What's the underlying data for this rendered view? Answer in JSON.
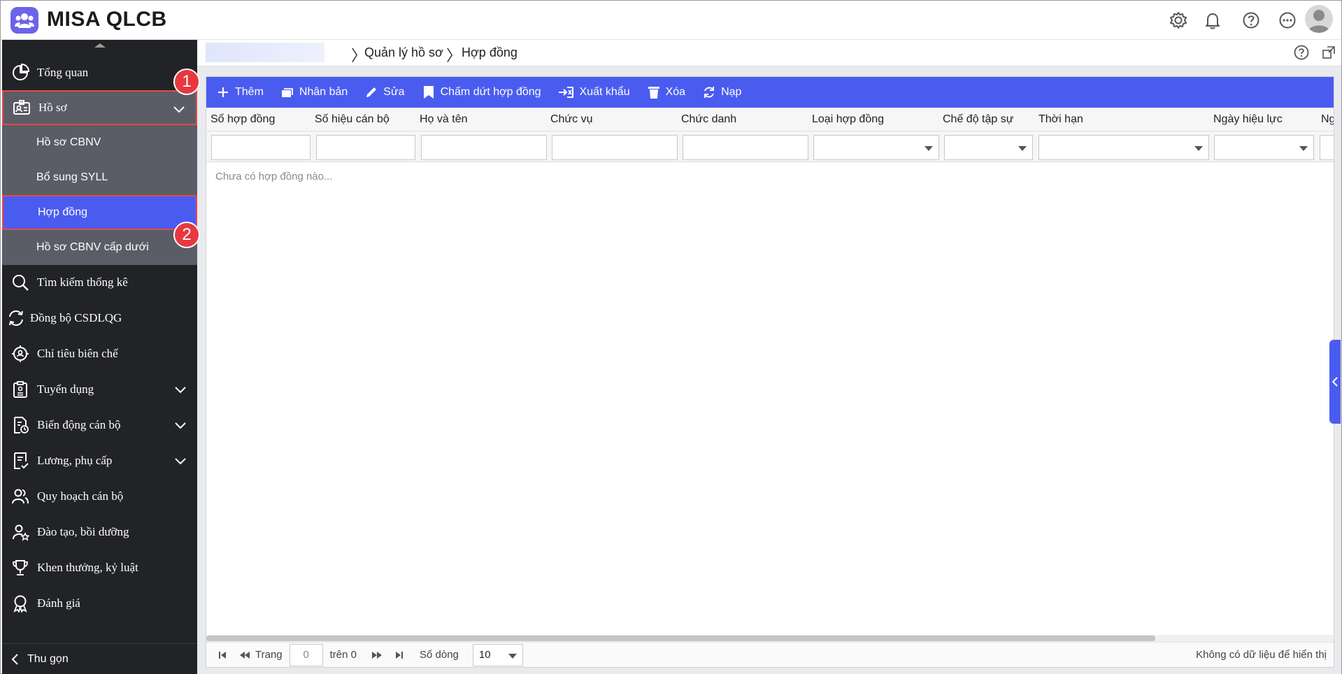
{
  "app": {
    "title": "MISA QLCB",
    "brand_color": "#6b64e8",
    "accent_color": "#4a5cf0"
  },
  "header_icons": [
    "gear-icon",
    "bell-icon",
    "help-icon",
    "more-icon",
    "avatar"
  ],
  "sidebar": {
    "items": [
      {
        "label": "Tổng quan",
        "icon": "pie-chart-icon"
      },
      {
        "label": "Hồ sơ",
        "icon": "id-card-icon"
      },
      {
        "label": "Tìm kiếm thống kê",
        "icon": "search-icon"
      },
      {
        "label": "Đồng bộ CSDLQG",
        "icon": "sync-icon"
      },
      {
        "label": "Chỉ tiêu biên chế",
        "icon": "target-icon"
      },
      {
        "label": "Tuyển dụng",
        "icon": "clipboard-icon"
      },
      {
        "label": "Biến động cán bộ",
        "icon": "document-chart-icon"
      },
      {
        "label": "Lương, phụ cấp",
        "icon": "receipt-icon"
      },
      {
        "label": "Quy hoạch cán bộ",
        "icon": "users-icon"
      },
      {
        "label": "Đào tạo, bồi dưỡng",
        "icon": "user-star-icon"
      },
      {
        "label": "Khen thưởng, kỷ luật",
        "icon": "trophy-icon"
      },
      {
        "label": "Đánh giá",
        "icon": "award-icon"
      }
    ],
    "sub_items": [
      {
        "label": "Hồ sơ CBNV"
      },
      {
        "label": "Bổ sung SYLL"
      },
      {
        "label": "Hợp đồng"
      },
      {
        "label": "Hồ sơ CBNV cấp dưới"
      }
    ],
    "badges": [
      "1",
      "2"
    ],
    "footer_label": "Thu gọn"
  },
  "breadcrumb": {
    "items": [
      "Quản lý hồ sơ",
      "Hợp đồng"
    ]
  },
  "toolbar": {
    "buttons": [
      {
        "label": "Thêm",
        "icon": "plus-icon"
      },
      {
        "label": "Nhân bản",
        "icon": "duplicate-icon"
      },
      {
        "label": "Sửa",
        "icon": "pencil-icon"
      },
      {
        "label": "Chấm dứt hợp đồng",
        "icon": "bookmark-icon"
      },
      {
        "label": "Xuất khẩu",
        "icon": "export-icon"
      },
      {
        "label": "Xóa",
        "icon": "trash-icon"
      },
      {
        "label": "Nạp",
        "icon": "refresh-icon"
      }
    ]
  },
  "table": {
    "columns": [
      "Số hợp đồng",
      "Số hiệu cán bộ",
      "Họ và tên",
      "Chức vụ",
      "Chức danh",
      "Loại hợp đồng",
      "Chế độ tập sự",
      "Thời hạn",
      "Ngày hiệu lực",
      "Ng"
    ],
    "empty_message": "Chưa có hợp đồng nào..."
  },
  "pager": {
    "page_label": "Trang",
    "page_value": "0",
    "of_label": "trên 0",
    "rows_label": "Số dòng",
    "rows_value": "10",
    "status": "Không có dữ liệu để hiển thị"
  }
}
